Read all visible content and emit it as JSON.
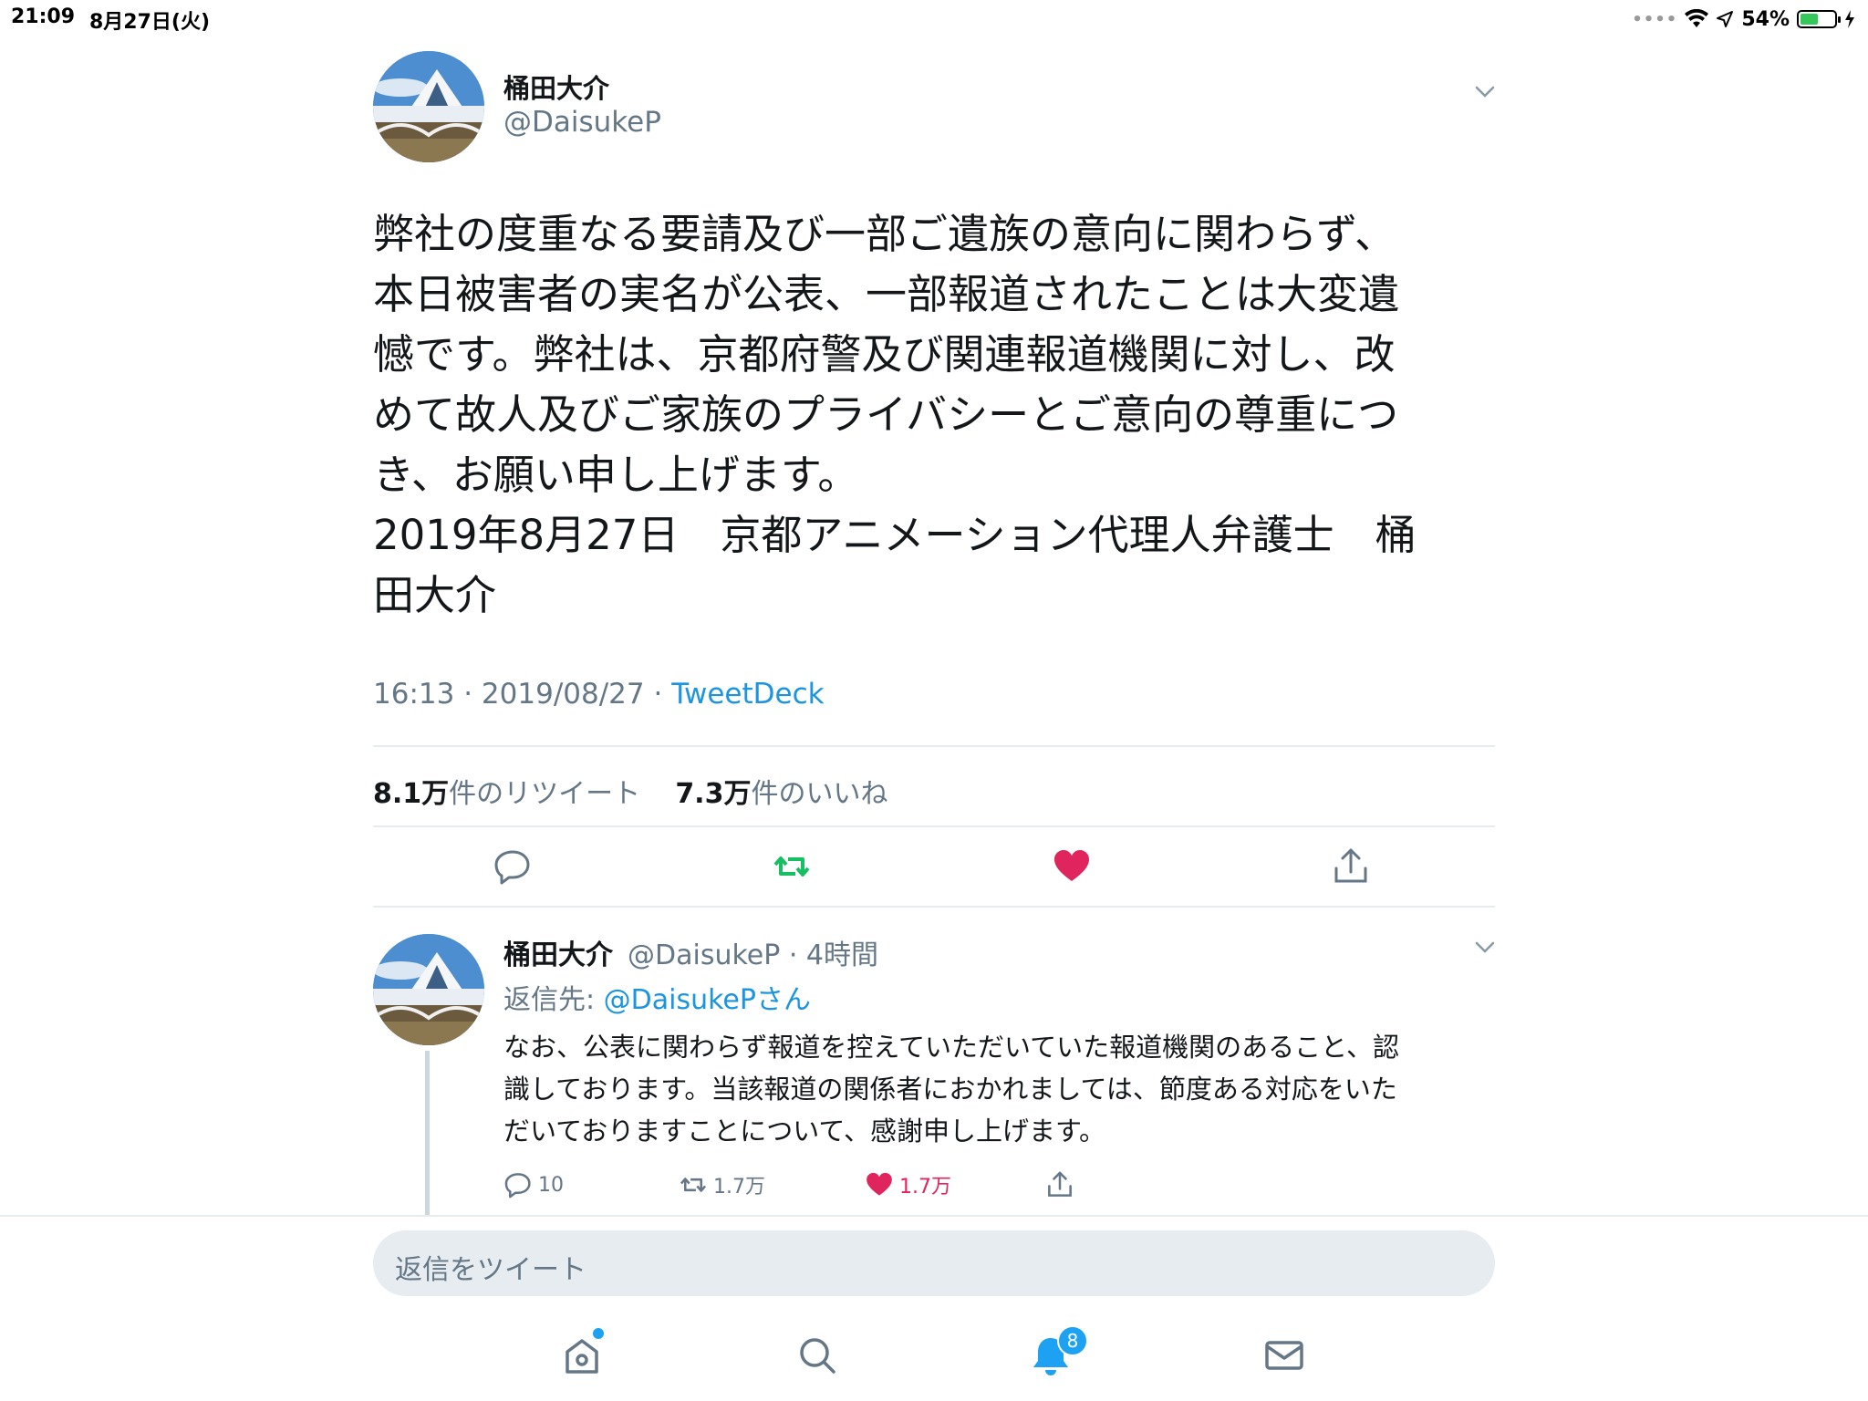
{
  "status_bar": {
    "time": "21:09",
    "date": "8月27日(火)",
    "battery": "54%",
    "battery_level": 0.54
  },
  "main_tweet": {
    "name": "桶田大介",
    "handle": "@DaisukeP",
    "text": "弊社の度重なる要請及び一部ご遺族の意向に関わらず、\n本日被害者の実名が公表、一部報道されたことは大変遺\n憾です。弊社は、京都府警及び関連報道機関に対し、改\nめて故人及びご家族のプライバシーとご意向の尊重につ\nき、お願い申し上げます。\n2019年8月27日　京都アニメーション代理人弁護士　桶\n田大介",
    "time": "16:13",
    "date": "2019/08/27",
    "separator": "·",
    "source": "TweetDeck",
    "retweet_count": "8.1万",
    "retweet_label": "件のリツイート",
    "like_count": "7.3万",
    "like_label": "件のいいね"
  },
  "reply_tweet": {
    "name": "桶田大介",
    "handle_time": "@DaisukeP · 4時間",
    "reply_to_label": "返信先: ",
    "reply_to_handle": "@DaisukePさん",
    "text": "なお、公表に関わらず報道を控えていただいていた報道機関のあること、認\n識しております。当該報道の関係者におかれましては、節度ある対応をいた\nだいておりますことについて、感謝申し上げます。",
    "reply_count": "10",
    "retweet_count": "1.7万",
    "like_count": "1.7万"
  },
  "composer": {
    "placeholder": "返信をツイート"
  },
  "tab_bar": {
    "notification_badge": "8"
  },
  "colors": {
    "retweet_active": "#17bf63",
    "like_active": "#e0245e",
    "link": "#1b95e0",
    "muted": "#657786"
  },
  "icons": [
    "reply-icon",
    "retweet-icon",
    "like-icon",
    "share-icon",
    "chevron-down-icon",
    "home-icon",
    "search-icon",
    "notifications-icon",
    "messages-icon",
    "wifi-icon",
    "location-icon",
    "battery-icon"
  ]
}
